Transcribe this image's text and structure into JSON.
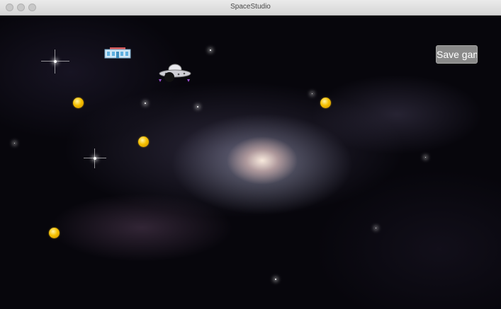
{
  "window": {
    "title": "SpaceStudio"
  },
  "game": {
    "save_button_label": "Save game",
    "coin_count": 4,
    "colors": {
      "coin": "#f5c000",
      "button_bg": "#8a8a8a",
      "button_text": "#ffffff",
      "space_bg": "#07060c"
    }
  },
  "icons": {
    "station": "space-station-icon",
    "ship": "ufo-spaceship-icon",
    "coin": "gold-coin-icon"
  }
}
